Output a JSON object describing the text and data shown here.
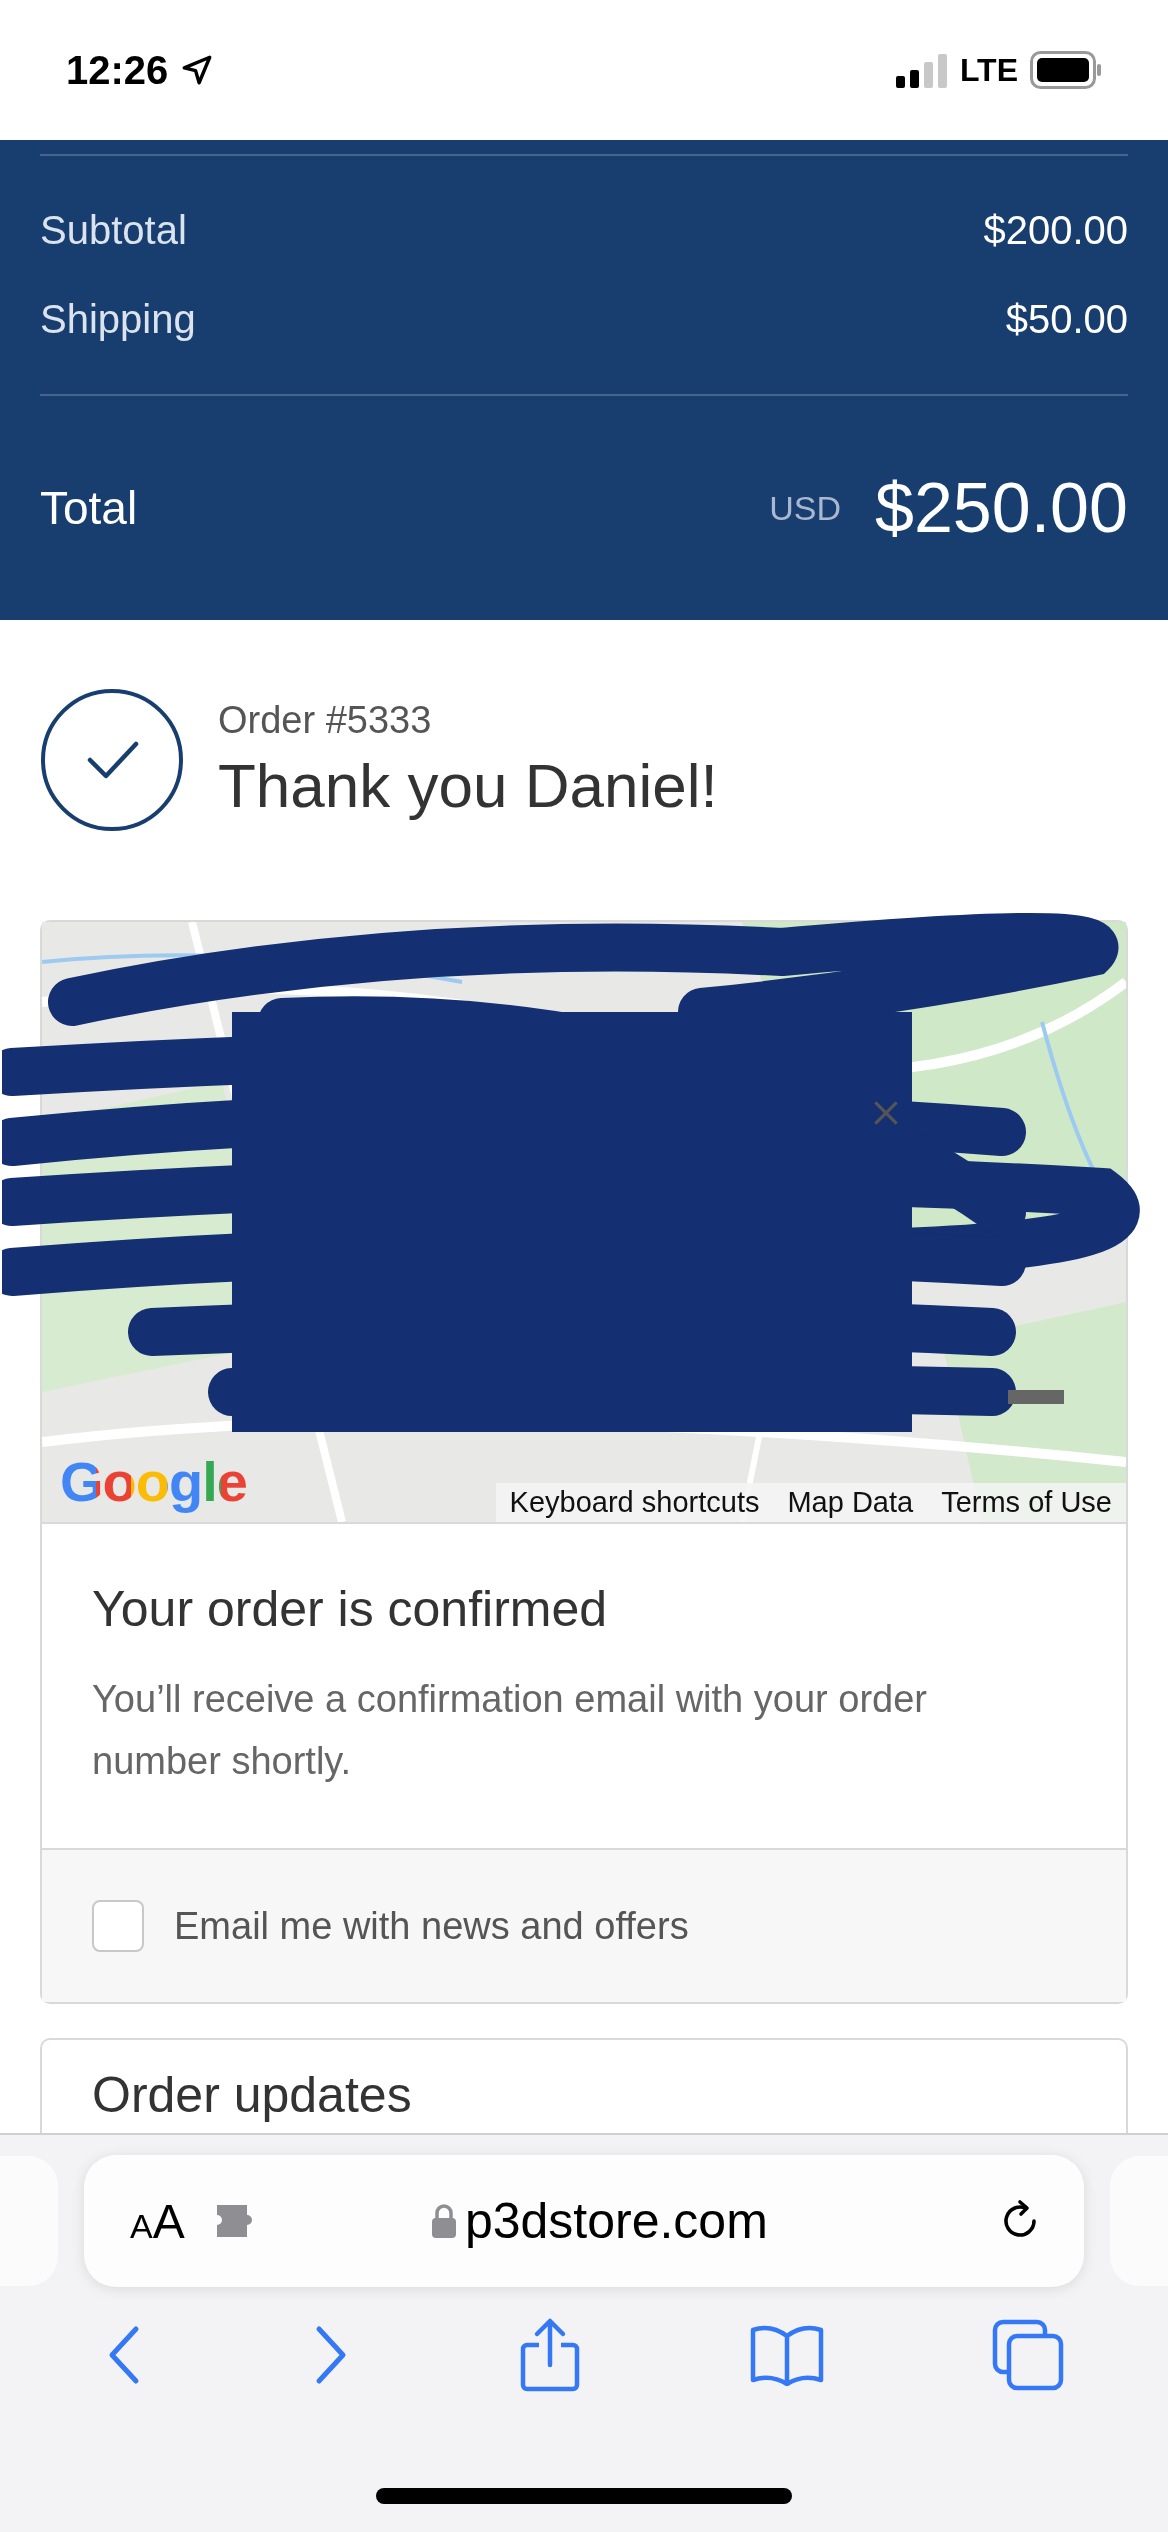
{
  "status_bar": {
    "time": "12:26",
    "network": "LTE"
  },
  "summary": {
    "rows": [
      {
        "label": "Subtotal",
        "amount": "$200.00"
      },
      {
        "label": "Shipping",
        "amount": "$50.00"
      }
    ],
    "total": {
      "label": "Total",
      "currency": "USD",
      "amount": "$250.00"
    }
  },
  "order": {
    "number": "Order #5333",
    "greeting": "Thank you Daniel!"
  },
  "map": {
    "kind": "picture",
    "logo": "Google",
    "links": [
      "Keyboard shortcuts",
      "Map Data",
      "Terms of Use"
    ]
  },
  "confirmation": {
    "title": "Your order is confirmed",
    "text": "You’ll receive a confirmation email with your order number shortly.",
    "newsletter": {
      "label": "Email me with news and offers",
      "checked": false
    }
  },
  "updates": {
    "title": "Order updates"
  },
  "browser": {
    "text_size": "AA",
    "url": "p3dstore.com"
  }
}
